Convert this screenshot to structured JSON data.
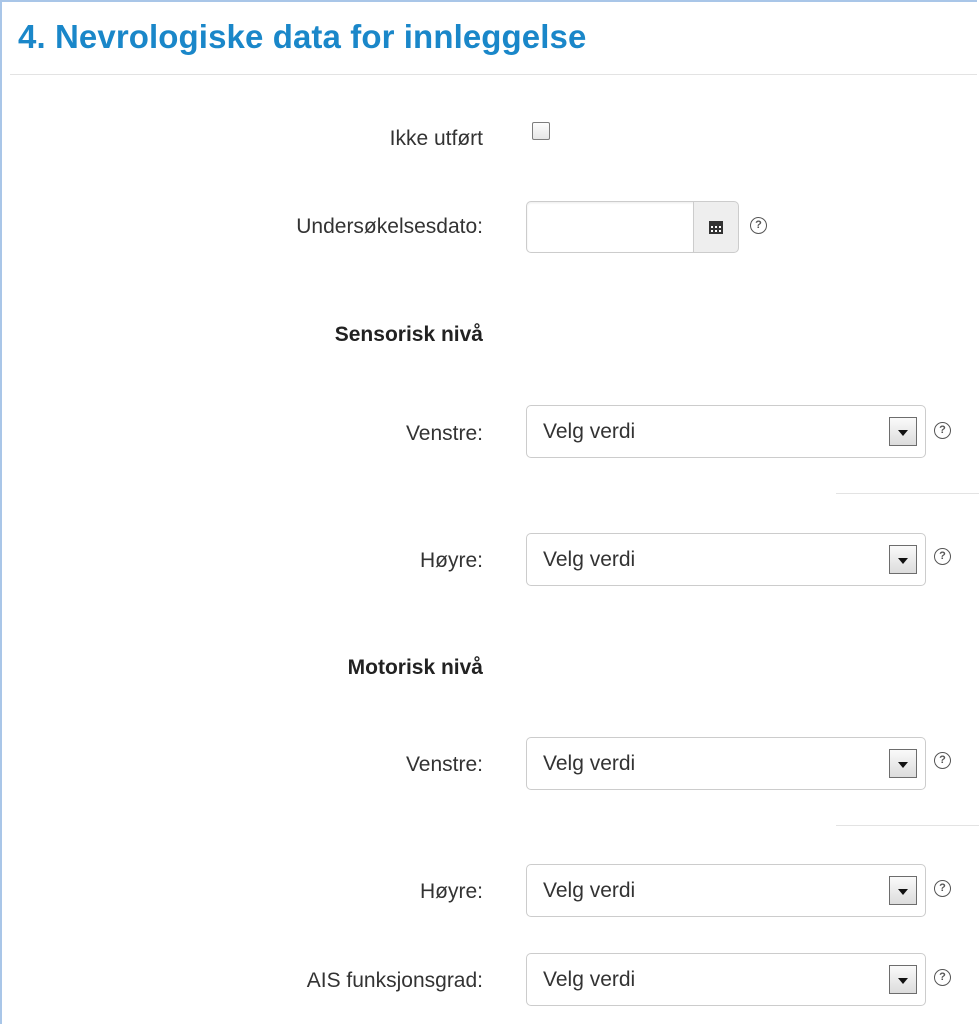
{
  "section": {
    "title": "4. Nevrologiske data for innleggelse"
  },
  "not_performed": {
    "label": "Ikke utført",
    "checked": false
  },
  "exam_date": {
    "label": "Undersøkelsesdato:",
    "value": "",
    "icon": "calendar-icon",
    "help_icon": "help-icon"
  },
  "sensory_level": {
    "heading": "Sensorisk nivå",
    "left": {
      "label": "Venstre:",
      "value": "Velg verdi"
    },
    "right": {
      "label": "Høyre:",
      "value": "Velg verdi"
    }
  },
  "motor_level": {
    "heading": "Motorisk nivå",
    "left": {
      "label": "Venstre:",
      "value": "Velg verdi"
    },
    "right": {
      "label": "Høyre:",
      "value": "Velg verdi"
    }
  },
  "ais_grade": {
    "label": "AIS funksjonsgrad:",
    "value": "Velg verdi"
  },
  "help_glyph": "?",
  "colors": {
    "title": "#1a87c9",
    "frame_border": "#a9c6e8",
    "text": "#333333",
    "field_border": "#cccccc"
  }
}
